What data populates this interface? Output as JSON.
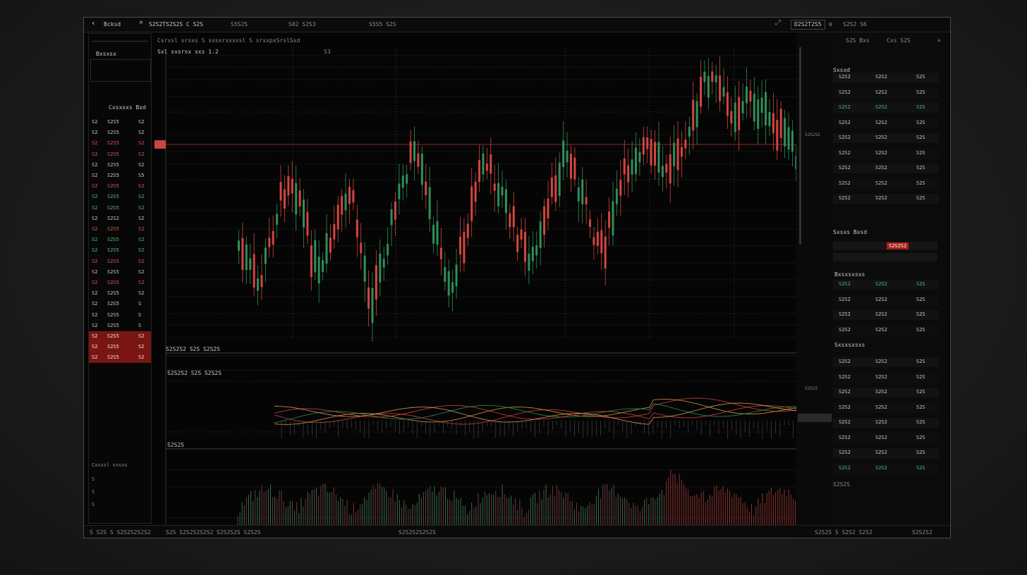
{
  "topbar": {
    "back_icon": "chevron-left-icon",
    "tab_label": "Bcksd",
    "search_icon": "search-icon",
    "symbol": "S2S2TS2S2S C S2S",
    "item2": "S5S2S",
    "item3": "S02  S2S3",
    "item4": "S5S5  S2S",
    "right_label": "D2S2T2S5",
    "right_item": "S2S2 S6"
  },
  "chart_toolbar": {
    "title": "Csrxsl  srsxs S sxsxrsxsxsl S srsxpxSrslSxd",
    "ohlc": "Sxl sxsrsx sxs 1.2",
    "marker": "S3"
  },
  "watchlist": {
    "header": "Bxsxsx",
    "subheader": "Cxsxsxs Bxd",
    "rows": [
      {
        "a": "S2",
        "b": "S2S5",
        "c": "S2",
        "hl": false,
        "col": "#c9c9c9"
      },
      {
        "a": "S2",
        "b": "S2S5",
        "c": "S2",
        "hl": false,
        "col": "#c9c9c9"
      },
      {
        "a": "S2",
        "b": "S2S5",
        "c": "S2",
        "hl": false,
        "col": "#e05a55"
      },
      {
        "a": "S2",
        "b": "S2S5",
        "c": "S2",
        "hl": false,
        "col": "#e05a55"
      },
      {
        "a": "S2",
        "b": "S2S5",
        "c": "S2",
        "hl": false,
        "col": "#c9c9c9"
      },
      {
        "a": "S2",
        "b": "S2S5",
        "c": "S5",
        "hl": false,
        "col": "#c9c9c9"
      },
      {
        "a": "S2",
        "b": "S2S5",
        "c": "S2",
        "hl": false,
        "col": "#e05a55"
      },
      {
        "a": "S2",
        "b": "S2S5",
        "c": "S2",
        "hl": false,
        "col": "#4fc07a"
      },
      {
        "a": "S2",
        "b": "S2S5",
        "c": "S2",
        "hl": false,
        "col": "#4fc07a"
      },
      {
        "a": "S2",
        "b": "S2S2",
        "c": "S2",
        "hl": false,
        "col": "#c9c9c9"
      },
      {
        "a": "S2",
        "b": "S2S5",
        "c": "S2",
        "hl": false,
        "col": "#e05a55"
      },
      {
        "a": "S2",
        "b": "S2S5",
        "c": "S2",
        "hl": false,
        "col": "#4fc07a"
      },
      {
        "a": "S2",
        "b": "S2S5",
        "c": "S2",
        "hl": false,
        "col": "#4fc07a"
      },
      {
        "a": "S2",
        "b": "S2S5",
        "c": "S2",
        "hl": false,
        "col": "#e05a55"
      },
      {
        "a": "S2",
        "b": "S2S5",
        "c": "S2",
        "hl": false,
        "col": "#c9c9c9"
      },
      {
        "a": "S2",
        "b": "S2S5",
        "c": "S2",
        "hl": false,
        "col": "#e05a55"
      },
      {
        "a": "S2",
        "b": "S2S5",
        "c": "S2",
        "hl": false,
        "col": "#c9c9c9"
      },
      {
        "a": "S2",
        "b": "S2S5",
        "c": "S",
        "hl": false,
        "col": "#c9c9c9"
      },
      {
        "a": "S2",
        "b": "S2S5",
        "c": "S",
        "hl": false,
        "col": "#c9c9c9"
      },
      {
        "a": "S2",
        "b": "S2S5",
        "c": "S",
        "hl": false,
        "col": "#c9c9c9"
      },
      {
        "a": "S2",
        "b": "S2S5",
        "c": "S2",
        "hl": true,
        "col": "#e8e8e8"
      },
      {
        "a": "S2",
        "b": "S2S5",
        "c": "S2",
        "hl": true,
        "col": "#e8e8e8"
      },
      {
        "a": "S2",
        "b": "S2S5",
        "c": "S2",
        "hl": true,
        "col": "#e8e8e8"
      }
    ],
    "footer1": "Cxsxsl  sxsxs",
    "footer2": "S",
    "footer3": "S",
    "footer4": "S"
  },
  "price_axis": [
    "S2S5S2",
    "S2S5S2",
    "S2S2S5",
    "S2S2S5",
    "S2S2S2",
    "S2S2S2",
    "S2S2S2",
    "S2S2S2",
    "S2S2S2",
    "S2S2S2",
    "S2S2S2",
    "S2S2S2",
    "S2S2S2",
    "S2S2S2"
  ],
  "indicator": {
    "label1": "S2S2S2 S2S S2S2S",
    "label2": "S2S2S2 S2S S2S2S",
    "label3": "S2S2S"
  },
  "bottombar": {
    "a": "S  S2S  S  S2S2S2S2S2",
    "b": "S2S  S2S2S2S2S2",
    "c": "S2S2S2S  S2S2S",
    "d": "S2S2S2S2S2S",
    "e": "S2S2S  S  S2S2  S2S2",
    "f": "S2S2S2"
  },
  "orderbook": {
    "title": "Cxs  S2S",
    "sec1": "Sxsxd",
    "sec2": "Sxsxs Bxsd",
    "sec3": "Bxsxsxsxs",
    "sec4": "Sxsxsxsxs",
    "rows": [
      {
        "l": "S2S2",
        "m": "S2S2",
        "r": "S2S",
        "col": "#c9c9c9"
      },
      {
        "l": "S2S2",
        "m": "S2S2",
        "r": "S2S",
        "col": "#c9c9c9"
      },
      {
        "l": "S2S2",
        "m": "S2S2",
        "r": "S2S",
        "col": "#4fc07a"
      },
      {
        "l": "S2S2",
        "m": "S2S2",
        "r": "S2S",
        "col": "#c9c9c9"
      },
      {
        "l": "S2S2",
        "m": "S2S2",
        "r": "S2S",
        "col": "#c9c9c9"
      },
      {
        "l": "S2S2",
        "m": "S2S2",
        "r": "S2S",
        "col": "#c9c9c9"
      },
      {
        "l": "S2S2",
        "m": "S2S2",
        "r": "S2S",
        "col": "#c9c9c9"
      },
      {
        "l": "S2S2",
        "m": "S2S2",
        "r": "S2S",
        "col": "#c9c9c9"
      },
      {
        "l": "S2S2",
        "m": "S2S2",
        "r": "S2S",
        "col": "#c9c9c9"
      }
    ]
  },
  "right_footer": "S2S2S"
}
